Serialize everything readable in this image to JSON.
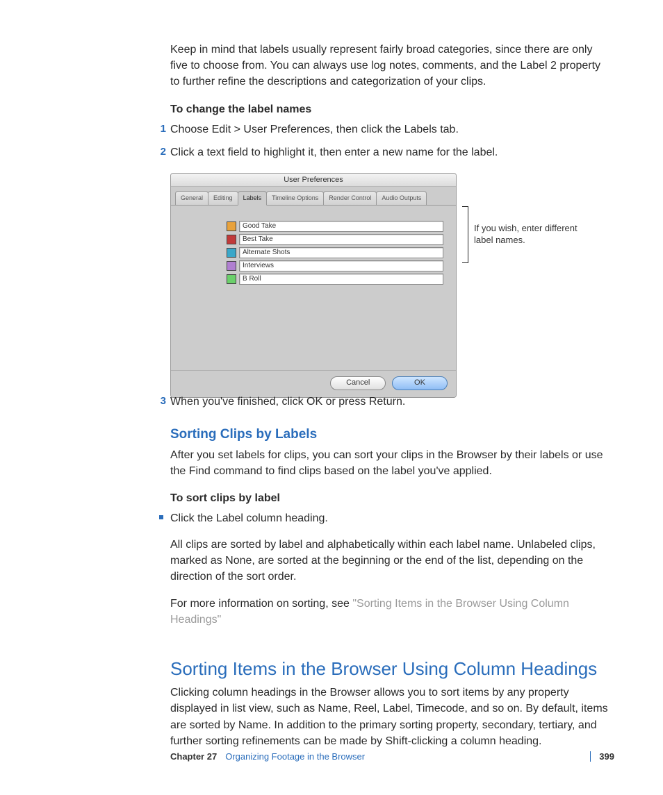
{
  "intro": "Keep in mind that labels usually represent fairly broad categories, since there are only five to choose from. You can always use log notes, comments, and the Label 2 property to further refine the descriptions and categorization of your clips.",
  "procTitle": "To change the label names",
  "steps": [
    "Choose Edit > User Preferences, then click the Labels tab.",
    "Click a text field to highlight it, then enter a new name for the label.",
    "When you've finished, click OK or press Return."
  ],
  "prefWin": {
    "title": "User Preferences",
    "tabs": [
      "General",
      "Editing",
      "Labels",
      "Timeline Options",
      "Render Control",
      "Audio Outputs"
    ],
    "activeTab": "Labels",
    "rows": [
      {
        "color": "#e8a23c",
        "label": "Good Take"
      },
      {
        "color": "#c03a3a",
        "label": "Best Take"
      },
      {
        "color": "#3aa7c9",
        "label": "Alternate Shots"
      },
      {
        "color": "#b07fd1",
        "label": "Interviews"
      },
      {
        "color": "#6bd06b",
        "label": "B Roll"
      }
    ],
    "cancel": "Cancel",
    "ok": "OK"
  },
  "callout": "If you wish, enter different label names.",
  "sec1": {
    "title": "Sorting Clips by Labels",
    "p1": "After you set labels for clips, you can sort your clips in the Browser by their labels or use the Find command to find clips based on the label you've applied.",
    "procTitle": "To sort clips by label",
    "bullet": "Click the Label column heading.",
    "p2": "All clips are sorted by label and alphabetically within each label name. Unlabeled clips, marked as None, are sorted at the beginning or the end of the list, depending on the direction of the sort order.",
    "p3a": "For more information on sorting, see ",
    "p3b": "\"Sorting Items in the Browser Using Column Headings\""
  },
  "sec2": {
    "title": "Sorting Items in the Browser Using Column Headings",
    "p1": "Clicking column headings in the Browser allows you to sort items by any property displayed in list view, such as Name, Reel, Label, Timecode, and so on. By default, items are sorted by Name. In addition to the primary sorting property, secondary, tertiary, and further sorting refinements can be made by Shift-clicking a column heading."
  },
  "footer": {
    "chapter": "Chapter 27",
    "title": "Organizing Footage in the Browser",
    "page": "399"
  }
}
